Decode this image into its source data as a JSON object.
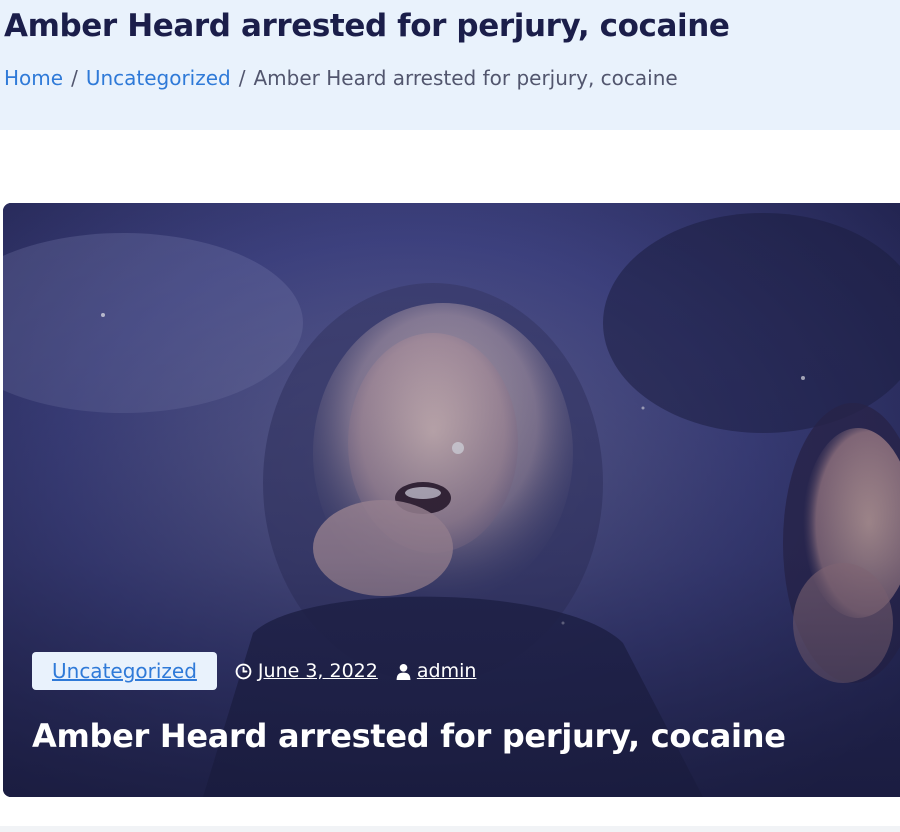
{
  "header": {
    "title": "Amber Heard arrested for perjury, cocaine",
    "breadcrumb": {
      "home": "Home",
      "separator": "/",
      "category": "Uncategorized",
      "current": "Amber Heard arrested for perjury, cocaine"
    }
  },
  "post": {
    "category": "Uncategorized",
    "date": "June 3, 2022",
    "author": "admin",
    "title": "Amber Heard arrested for perjury, cocaine",
    "date_icon": "clock-icon",
    "author_icon": "user-icon"
  },
  "colors": {
    "header_bg": "#e9f2fc",
    "title_color": "#1b1e4a",
    "link_color": "#2f7ad8",
    "hero_overlay": "#2c2f63"
  }
}
